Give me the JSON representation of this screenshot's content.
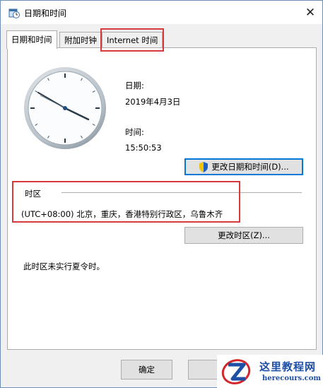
{
  "window": {
    "title": "日期和时间"
  },
  "tabs": [
    {
      "label": "日期和时间",
      "active": true
    },
    {
      "label": "附加时钟",
      "active": false
    },
    {
      "label": "Internet 时间",
      "active": false
    }
  ],
  "date": {
    "label": "日期:",
    "value": "2019年4月3日"
  },
  "time": {
    "label": "时间:",
    "value": "15:50:53"
  },
  "change_datetime_button": "更改日期和时间(D)...",
  "timezone": {
    "heading": "时区",
    "value": "(UTC+08:00) 北京，重庆，香港特别行政区，乌鲁木齐",
    "change_button": "更改时区(Z)..."
  },
  "dst_note": "此时区未实行夏令时。",
  "footer": {
    "ok_label": "确定"
  },
  "watermark": {
    "cn": "这里教程网",
    "en": "herecours.com"
  },
  "colors": {
    "highlight_box": "#d63a3a",
    "accent": "#0078d7"
  }
}
